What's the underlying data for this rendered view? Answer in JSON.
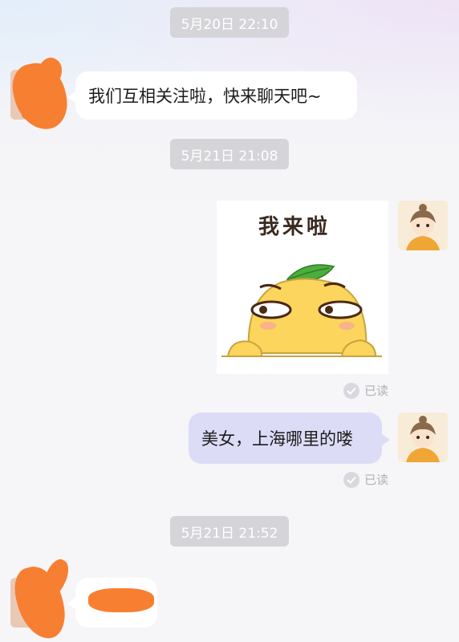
{
  "timestamps": [
    "5月20日 22:10",
    "5月21日 21:08",
    "5月21日 21:52"
  ],
  "messages": [
    {
      "side": "left",
      "text": "我们互相关注啦，快来聊天吧~"
    },
    {
      "side": "right",
      "type": "sticker",
      "sticker_text": "我来啦"
    },
    {
      "side": "right",
      "text": "美女，上海哪里的喽"
    },
    {
      "side": "left",
      "text": ""
    }
  ],
  "read_label": "已读",
  "colors": {
    "right_bubble": "#dcdcf7",
    "left_bubble": "#ffffff",
    "time_pill": "#d5d5d9",
    "redaction": "#f77f32"
  }
}
